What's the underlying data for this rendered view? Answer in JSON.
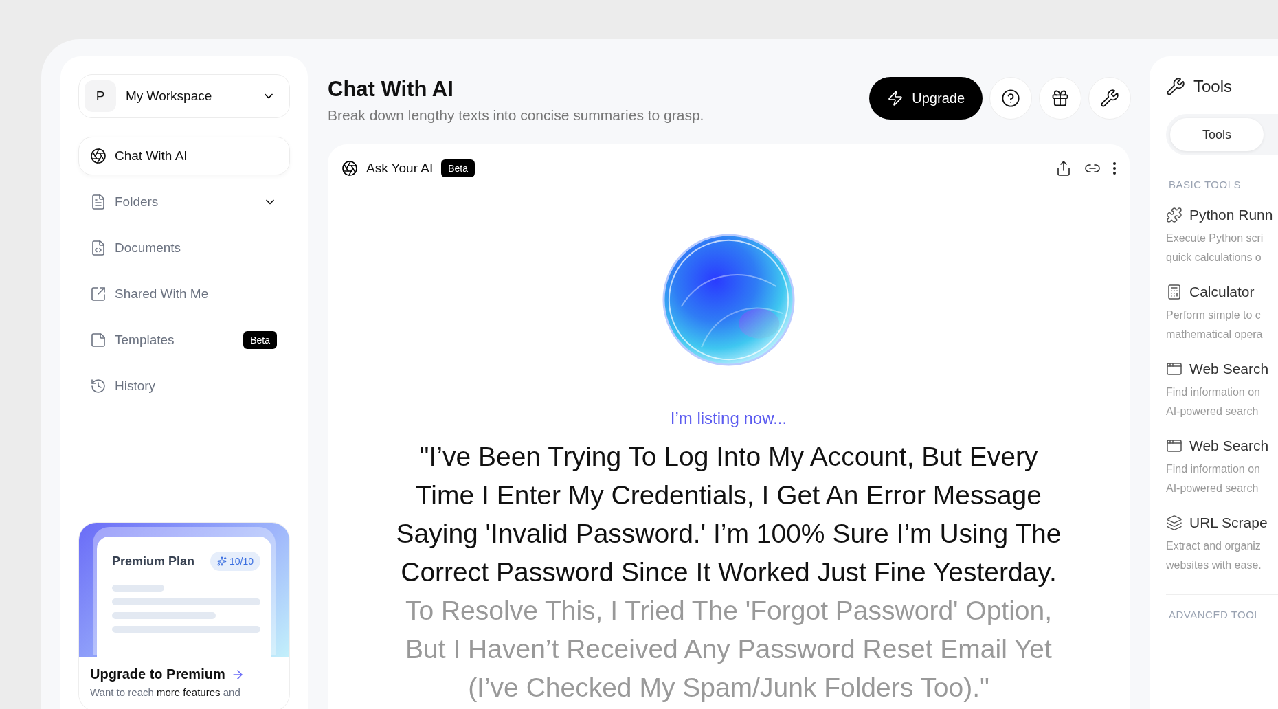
{
  "workspace": {
    "initial": "P",
    "name": "My Workspace"
  },
  "nav": [
    {
      "label": "Chat With AI",
      "selected": true
    },
    {
      "label": "Folders",
      "selected": false,
      "kind": "group"
    },
    {
      "label": "Documents",
      "selected": false
    },
    {
      "label": "Shared With Me",
      "selected": false
    },
    {
      "label": "Templates",
      "selected": false,
      "badge": "Beta"
    },
    {
      "label": "History",
      "selected": false
    }
  ],
  "promo": {
    "plan": "Premium Plan",
    "credits": "10/10",
    "title": "Upgrade to Premium",
    "text": "Want to reach **more features** and"
  },
  "header": {
    "title": "Chat With AI",
    "subtitle": "Break down lengthy texts into concise summaries to grasp.",
    "upgrade": "Upgrade"
  },
  "chat": {
    "title": "Ask Your AI",
    "badge": "Beta",
    "status": "I’m listing now...",
    "spoken": "\"I’ve Been Trying To Log Into My Account, But Every Time I Enter My Credentials, I Get An Error Message Saying 'Invalid Password.' I’m 100% Sure I’m Using The Correct Password Since It Worked Just Fine Yesterday.",
    "pending": "To Resolve This, I Tried The 'Forgot Password' Option, But I Haven’t Received Any Password Reset Email Yet (I’ve Checked My Spam/Junk Folders Too).\""
  },
  "tools_panel": {
    "title": "Tools",
    "tabs": [
      {
        "label": "Tools",
        "selected": true
      }
    ],
    "sections": [
      {
        "heading": "BASIC TOOLS",
        "tools": [
          {
            "name": "Python Runn",
            "description": "Execute Python scri\nquick calculations o"
          },
          {
            "name": "Calculator",
            "description": "Perform simple to c\nmathematical opera"
          },
          {
            "name": "Web Search",
            "description": "Find information on\nAI-powered search"
          },
          {
            "name": "Web Search",
            "description": "Find information on\nAI-powered search"
          },
          {
            "name": "URL Scrape",
            "description": "Extract and organiz\nwebsites with ease."
          }
        ]
      },
      {
        "heading": "ADVANCED TOOL"
      }
    ]
  }
}
